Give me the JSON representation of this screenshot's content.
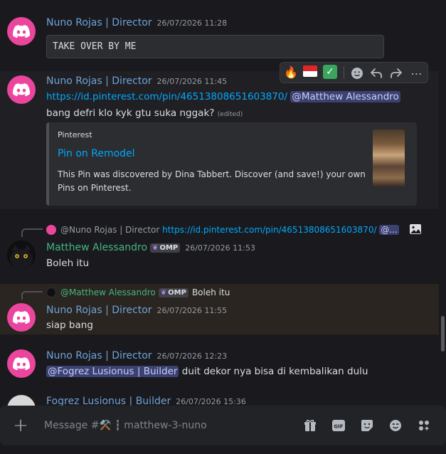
{
  "messages": {
    "m1": {
      "author": "Nuno Rojas | Director",
      "time": "26/07/2026 11:28",
      "code": "TAKE OVER BY ME"
    },
    "m2": {
      "author": "Nuno Rojas | Director",
      "time": "26/07/2026 11:45",
      "link": "https://id.pinterest.com/pin/46513808651603870/",
      "mention": "@Matthew Alessandro",
      "text": "bang defri klo kyk gtu suka nggak?",
      "edited": "(edited)",
      "embed": {
        "provider": "Pinterest",
        "title": "Pin on Remodel",
        "desc1": "This Pin was discovered by Dina Tabbert. Discover (and save!) your own",
        "desc2": "Pins on Pinterest."
      },
      "reactions": {
        "fire": "🔥",
        "flag": "🇮🇩",
        "check": "✅"
      }
    },
    "m3": {
      "reply_author": "@Nuno Rojas | Director",
      "reply_link": "https://id.pinterest.com/pin/46513808651603870/",
      "reply_mention": "@...",
      "author": "Matthew Alessandro",
      "badge": "OMP",
      "time": "26/07/2026 11:53",
      "text": "Boleh itu"
    },
    "m4": {
      "reply_author": "@Matthew Alessandro",
      "reply_badge": "OMP",
      "reply_text": "Boleh itu",
      "author": "Nuno Rojas | Director",
      "time": "26/07/2026 11:55",
      "text": "siap bang"
    },
    "m5": {
      "author": "Nuno Rojas | Director",
      "time": "26/07/2026 12:23",
      "mention": "@Fogrez Lusionus | Builder",
      "text": "duit dekor nya bisa di kembalikan dulu"
    },
    "m6": {
      "author": "Fogrez Lusionus | Builder",
      "time": "26/07/2026 15:36"
    }
  },
  "composer": {
    "placeholder": "Message #⚒️ ┇ matthew-3-nuno"
  },
  "colors": {
    "background": "#1a1a1e",
    "accent": "#5865f2",
    "avatar": "#eb459e",
    "highlight": "#2a2520"
  }
}
